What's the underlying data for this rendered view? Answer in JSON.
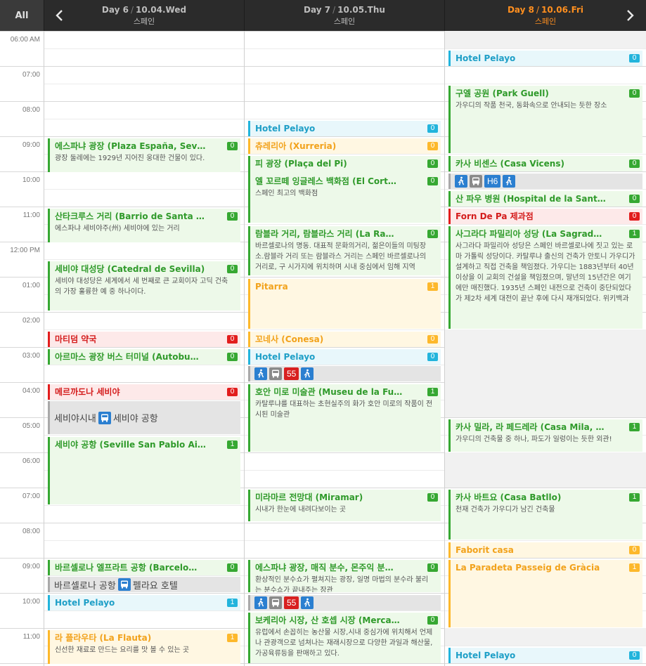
{
  "header": {
    "all_tab": "All",
    "days": [
      {
        "day": "Day 6",
        "date": "10.04.Wed",
        "country": "스페인"
      },
      {
        "day": "Day 7",
        "date": "10.05.Thu",
        "country": "스페인"
      },
      {
        "day": "Day 8",
        "date": "10.06.Fri",
        "country": "스페인",
        "active": true
      }
    ],
    "sep": "/"
  },
  "time_labels": [
    "06:00 AM",
    "07:00",
    "08:00",
    "09:00",
    "10:00",
    "11:00",
    "12:00 PM",
    "01:00",
    "02:00",
    "03:00",
    "04:00",
    "05:00",
    "06:00",
    "07:00",
    "08:00",
    "09:00",
    "10:00",
    "11:00"
  ],
  "colors": {
    "green": "#36a832",
    "blue": "#22b4dc",
    "orange": "#fdb82b",
    "red": "#e21d1d",
    "accent": "#ff8f1f"
  },
  "day6": {
    "events": [
      {
        "title": "에스파냐 광장 (Plaza España, Sev…",
        "badge": "0",
        "desc": "광장 둘레에는 1929년 지어진 웅대한 건물이 있다."
      },
      {
        "title": "산타크루스 거리 (Barrio de Santa …",
        "badge": "0",
        "desc": "에스파냐 세비야주(州) 세비야에 있는 거리"
      },
      {
        "title": "세비야 대성당 (Catedral de Sevilla)",
        "badge": "0",
        "desc": "세비야 대성당은 세계에서 세 번째로 큰 교회이자 고딕 건축의 가장 훌륭한 예 중 하나이다."
      },
      {
        "title": "마티덤 약국",
        "badge": "0"
      },
      {
        "title": "아르마스 광장 버스 터미널 (Autobu…",
        "badge": "0"
      },
      {
        "title": "메르까도나 세비야",
        "badge": "0"
      },
      {
        "title": "세비야 공항 (Seville San Pablo Ai…",
        "badge": "1"
      },
      {
        "title": "바르셀로나 엘프라트 공항 (Barcelo…",
        "badge": "0"
      },
      {
        "title": "Hotel Pelayo",
        "badge": "1"
      },
      {
        "title": "라 플라우타 (La Flauta)",
        "badge": "1",
        "desc": "신선한 재료로 만드는 요리를 맛 볼 수 있는 곳"
      }
    ],
    "transit1": {
      "from": "세비야시내",
      "to": "세비야 공항"
    },
    "transit2": {
      "from": "바르셀로나 공항",
      "to": "펠라요 호텔"
    }
  },
  "day7": {
    "events": [
      {
        "title": "Hotel Pelayo",
        "badge": "0"
      },
      {
        "title": "츄레리아 (Xurreria)",
        "badge": "0"
      },
      {
        "title": "피 광장 (Plaça del Pi)",
        "badge": "0"
      },
      {
        "title": "엘 꼬르떼 잉글레스 백화점 (El Cort…",
        "badge": "0",
        "desc": "스페인 최고의 백화점"
      },
      {
        "title": "람블라 거리, 람블라스 거리 (La Ra…",
        "badge": "0",
        "desc": "바르셀로나의 명동. 대표적 문화의거리, 젊은이들의 미팅장소.람블라 거리 또는 람블라스 거리는 스페인 바르셀로나의 거리로, 구 시가지에 위치하며 시내 중심에서 임해 지역"
      },
      {
        "title": "Pitarra",
        "badge": "1"
      },
      {
        "title": "꼬네사 (Conesa)",
        "badge": "0"
      },
      {
        "title": "Hotel Pelayo",
        "badge": "0"
      },
      {
        "title": "호안 미로 미술관 (Museu de la Fu…",
        "badge": "1",
        "desc": "카탈루냐를 대표하는 초현실주의 화가 호안 미로의 작품이 전시된 미술관"
      },
      {
        "title": "미라마르 전망대 (Miramar)",
        "badge": "0",
        "desc": "시내가 한눈에 내려다보이는 곳"
      },
      {
        "title": "에스파냐 광장, 매직 분수, 몬주익 분…",
        "badge": "0",
        "desc": "환상적인 분수쇼가 펼쳐지는 광장, 일명 마법의 분수라 불리는 분수쇼가 끝내주는 장관"
      },
      {
        "title": "보케리아 시장, 산 호셉 시장 (Merca…",
        "badge": "0",
        "desc": "유럽에서 손꼽히는 농산물 시장,시내 중심가에 위치해서 언제나 관광객으로 넘쳐나는 재래시장으로 다양한 과일과 해산물, 가공육류등을 판매하고 있다."
      }
    ],
    "transit1": {
      "route": "55"
    },
    "transit2": {
      "route": "55"
    }
  },
  "day8": {
    "events": [
      {
        "title": "Hotel Pelayo",
        "badge": "0"
      },
      {
        "title": "구엘 공원 (Park Guell)",
        "badge": "0",
        "desc": "가우디의 작품 천국, 동화속으로 안내되는 듯한 장소"
      },
      {
        "title": "카사 비센스 (Casa Vicens)",
        "badge": "0"
      },
      {
        "title": "산 파우 병원 (Hospital de la Sant…",
        "badge": "0"
      },
      {
        "title": "Forn De Pa 제과점",
        "badge": "0"
      },
      {
        "title": "사그라다 파밀리아 성당 (La Sagrad…",
        "badge": "1",
        "desc": "사그라다 파밀리아 성당은 스페인 바르셀로나에 짓고 있는 로마 가톨릭 성당이다. 카탈루냐 출신의 건축가 안토니 가우디가 설계하고 직접 건축을 책임졌다. 가우디는 1883년부터 40년 이상을 이 교회의 건설을 책임졌으며, 말년의 15년간은 여기에만 매진했다. 1935년 스페인 내전으로 건축이 중단되었다가 제2차 세계 대전이 끝난 후에 다시 재개되었다. 위키백과"
      },
      {
        "title": "카사 밀라, 라 페드레라 (Casa Mila, …",
        "badge": "1",
        "desc": "가우디의 건축물 중 하나, 파도가 일렁이는 듯한 외관!"
      },
      {
        "title": "카사 바트요 (Casa Batllo)",
        "badge": "1",
        "desc": "천재 건축가 가우디가 남긴 건축물"
      },
      {
        "title": "Faborit casa",
        "badge": "0"
      },
      {
        "title": "La Paradeta Passeig de Gràcia",
        "badge": "1"
      },
      {
        "title": "Hotel Pelayo",
        "badge": "0"
      }
    ],
    "transit1": {
      "route": "H6"
    }
  }
}
